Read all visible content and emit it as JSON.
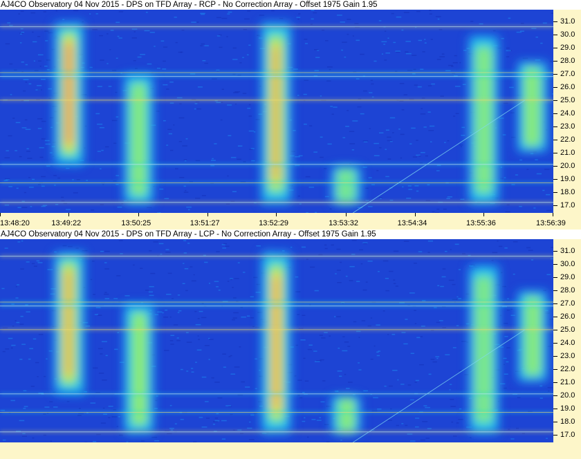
{
  "chart_data": [
    {
      "type": "heatmap",
      "title": "AJ4CO Observatory 04 Nov 2015 - DPS on TFD Array  - RCP  -  No Correction Array  -  Offset 1975  Gain 1.95",
      "x_ticks": [
        "13:48:20",
        "13:49:22",
        "13:50:25",
        "13:51:27",
        "13:52:29",
        "13:53:32",
        "13:54:34",
        "13:55:36",
        "13:56:39"
      ],
      "y_ticks": [
        "31.0",
        "30.0",
        "29.0",
        "28.0",
        "27.0",
        "26.0",
        "25.0",
        "24.0",
        "23.0",
        "22.0",
        "21.0",
        "20.0",
        "19.0",
        "18.0",
        "17.0"
      ],
      "ylim": [
        16.4,
        31.9
      ],
      "colormap": [
        "#1d44d4",
        "#1e8af0",
        "#22d6e8",
        "#9ef060",
        "#f5e23a",
        "#f7a04a",
        "#f0607a"
      ],
      "features": [
        {
          "time": "13:49:22",
          "freq_range": [
            20.0,
            31.0
          ],
          "peak_intensity": 0.95
        },
        {
          "time": "13:50:25",
          "freq_range": [
            17.0,
            27.0
          ],
          "peak_intensity": 0.55
        },
        {
          "time": "13:52:29",
          "freq_range": [
            17.0,
            31.0
          ],
          "peak_intensity": 0.9
        },
        {
          "time": "13:53:32",
          "freq_range": [
            17.0,
            20.0
          ],
          "peak_intensity": 0.5
        },
        {
          "time": "13:55:36",
          "freq_range": [
            17.0,
            30.0
          ],
          "peak_intensity": 0.45
        },
        {
          "time": "13:56:20",
          "freq_range": [
            21.0,
            28.0
          ],
          "peak_intensity": 0.55
        }
      ],
      "rfi_lines_mhz": [
        30.6,
        27.1,
        26.8,
        25.0,
        20.1,
        18.7,
        17.2
      ]
    },
    {
      "type": "heatmap",
      "title": "AJ4CO Observatory 04 Nov 2015 - DPS on TFD Array  - LCP  -  No Correction Array  -  Offset 1975  Gain 1.95",
      "x_ticks": [],
      "y_ticks": [
        "31.0",
        "30.0",
        "29.0",
        "28.0",
        "27.0",
        "26.0",
        "25.0",
        "24.0",
        "23.0",
        "22.0",
        "21.0",
        "20.0",
        "19.0",
        "18.0",
        "17.0"
      ],
      "ylim": [
        16.4,
        31.9
      ],
      "colormap": [
        "#1d44d4",
        "#1e8af0",
        "#22d6e8",
        "#9ef060",
        "#f5e23a",
        "#f7a04a",
        "#f0607a"
      ],
      "features": [
        {
          "time": "13:49:22",
          "freq_range": [
            20.0,
            31.0
          ],
          "peak_intensity": 0.85
        },
        {
          "time": "13:50:25",
          "freq_range": [
            17.0,
            27.0
          ],
          "peak_intensity": 0.55
        },
        {
          "time": "13:52:29",
          "freq_range": [
            17.0,
            31.0
          ],
          "peak_intensity": 0.9
        },
        {
          "time": "13:53:32",
          "freq_range": [
            17.0,
            20.0
          ],
          "peak_intensity": 0.5
        },
        {
          "time": "13:55:36",
          "freq_range": [
            17.0,
            30.0
          ],
          "peak_intensity": 0.45
        },
        {
          "time": "13:56:20",
          "freq_range": [
            21.0,
            28.0
          ],
          "peak_intensity": 0.5
        }
      ],
      "rfi_lines_mhz": [
        30.6,
        27.1,
        26.8,
        25.0,
        20.1,
        18.7,
        17.2
      ]
    }
  ]
}
